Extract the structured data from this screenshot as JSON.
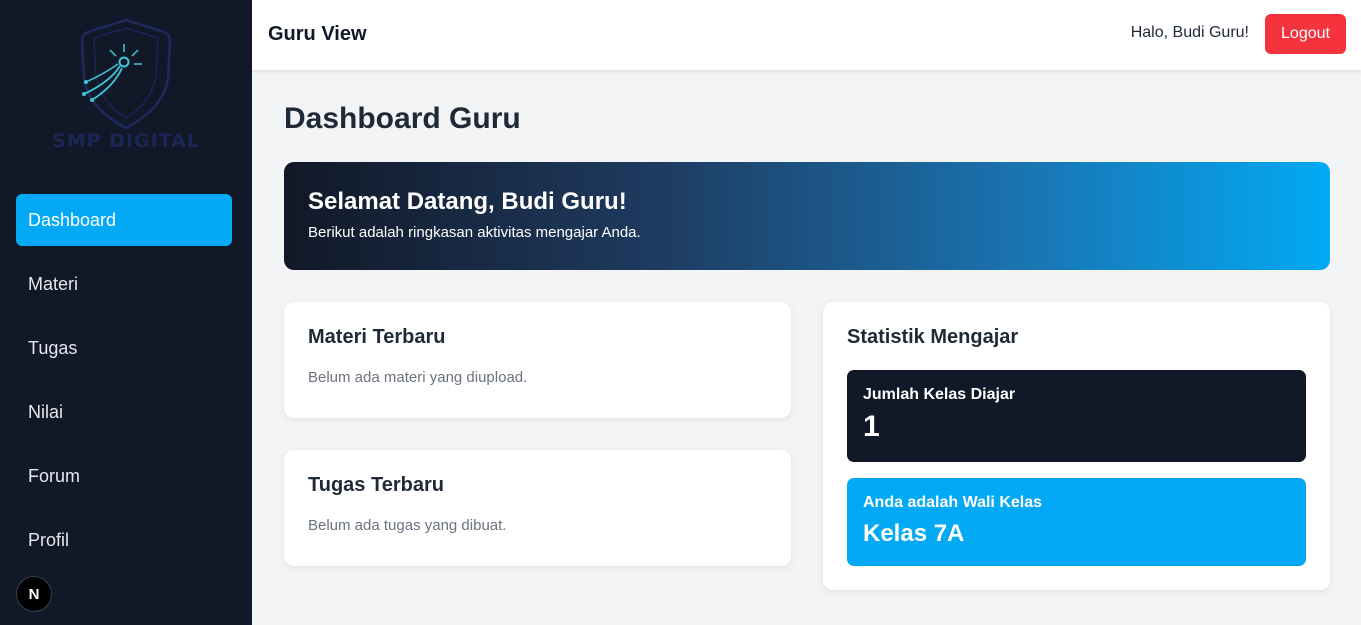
{
  "brand": {
    "name": "SMP DIGITAL",
    "logo_icon": "shield-circuit-icon"
  },
  "sidebar": {
    "items": [
      {
        "label": "Dashboard",
        "active": true
      },
      {
        "label": "Materi",
        "active": false
      },
      {
        "label": "Tugas",
        "active": false
      },
      {
        "label": "Nilai",
        "active": false
      },
      {
        "label": "Forum",
        "active": false
      },
      {
        "label": "Profil",
        "active": false
      }
    ],
    "badge": "N"
  },
  "header": {
    "title": "Guru View",
    "greeting": "Halo, Budi Guru!",
    "logout_label": "Logout"
  },
  "main": {
    "page_title": "Dashboard Guru",
    "welcome": {
      "title": "Selamat Datang, Budi Guru!",
      "subtitle": "Berikut adalah ringkasan aktivitas mengajar Anda."
    },
    "materi": {
      "title": "Materi Terbaru",
      "empty": "Belum ada materi yang diupload."
    },
    "tugas": {
      "title": "Tugas Terbaru",
      "empty": "Belum ada tugas yang dibuat."
    },
    "statistik": {
      "title": "Statistik Mengajar",
      "jumlah_label": "Jumlah Kelas Diajar",
      "jumlah_value": "1",
      "wali_label": "Anda adalah Wali Kelas",
      "wali_value": "Kelas 7A"
    }
  },
  "colors": {
    "sidebar_bg": "#111827",
    "accent": "#03a9f4",
    "danger": "#f4333d",
    "page_bg": "#f3f4f6"
  }
}
